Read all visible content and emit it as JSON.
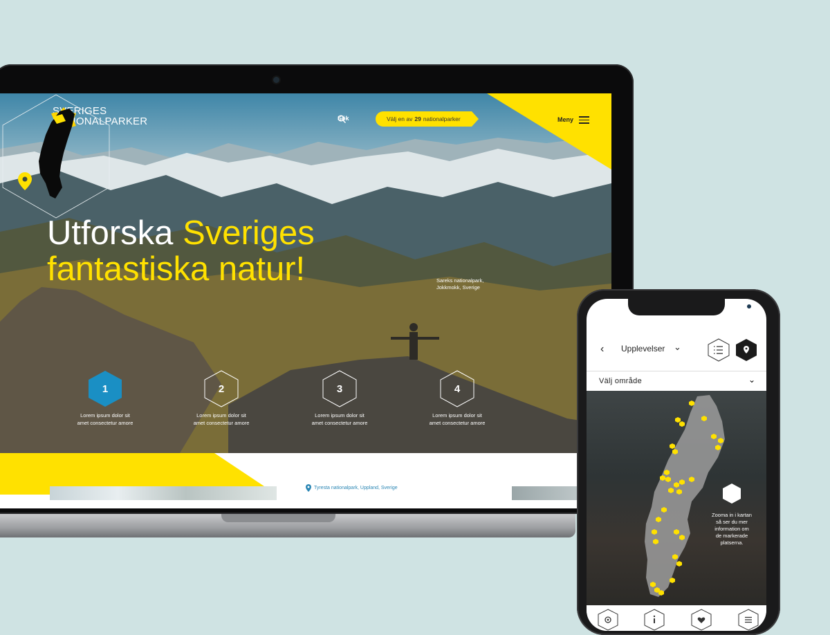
{
  "brand": {
    "line1": "SVERIGES",
    "line2": "NATIONALPARKER"
  },
  "nav": {
    "search_label": "Sök",
    "park_pill_prefix": "Välj en av",
    "park_pill_count": "29",
    "park_pill_suffix": "nationalparker",
    "menu_label": "Meny"
  },
  "hero": {
    "headline_white": "Utforska",
    "headline_yellow_1": "Sveriges",
    "headline_yellow_2": "fantastiska natur!",
    "location_line1": "Sareks nationalpark,",
    "location_line2": "Jokkmokk, Sverige"
  },
  "steps": [
    {
      "number": "1",
      "line1": "Lorem ipsum dolor sit",
      "line2": "amet consectetur amore"
    },
    {
      "number": "2",
      "line1": "Lorem ipsum dolor sit",
      "line2": "amet consectetur amore"
    },
    {
      "number": "3",
      "line1": "Lorem ipsum dolor sit",
      "line2": "amet consectetur amore"
    },
    {
      "number": "4",
      "line1": "Lorem ipsum dolor sit",
      "line2": "amet consectetur amore"
    }
  ],
  "below": {
    "location": "Tyresta nationalpark, Uppland, Sverige"
  },
  "phone": {
    "dropdown_label": "Upplevelser",
    "select_label": "Välj område",
    "tip_line1": "Zooma in i kartan",
    "tip_line2": "så ser du mer",
    "tip_line3": "information om",
    "tip_line4": "de markerade",
    "tip_line5": "platserna.",
    "tab_icons": [
      "gear-icon",
      "info-icon",
      "heart-icon",
      "menu-icon"
    ]
  },
  "colors": {
    "accent_yellow": "#ffe100",
    "active_blue": "#1a8fc4",
    "background": "#cfe3e3"
  }
}
